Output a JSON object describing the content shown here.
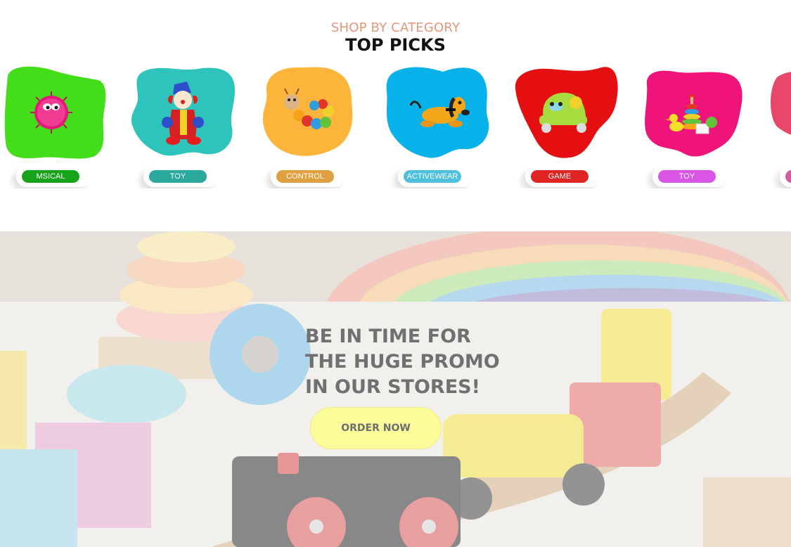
{
  "section": {
    "kicker": "SHOP BY CATEGORY",
    "title": "TOP PICKS"
  },
  "categories": [
    {
      "label": "MSICAL",
      "blob_color": "#44dd1a",
      "pill_color": "#18a41a",
      "toy": "pink-fluffy-ball"
    },
    {
      "label": "TOY",
      "blob_color": "#2fc4bb",
      "pill_color": "#2aa99c",
      "toy": "clown-doll"
    },
    {
      "label": "CONTROL",
      "blob_color": "#fcb53a",
      "pill_color": "#e1a040",
      "toy": "wooden-caterpillar"
    },
    {
      "label": "ACTIVEWEAR",
      "blob_color": "#09b1e9",
      "pill_color": "#4fc0dc",
      "toy": "plush-dog"
    },
    {
      "label": "GAME",
      "blob_color": "#e40f10",
      "pill_color": "#e02424",
      "toy": "toy-car"
    },
    {
      "label": "TOY",
      "blob_color": "#ee1479",
      "pill_color": "#d855e6",
      "toy": "stacking-rings-duck"
    },
    {
      "label": "",
      "blob_color": "#e8476a",
      "pill_color": "#d45aa0",
      "toy": ""
    }
  ],
  "promo": {
    "headline_1": "BE IN TIME FOR",
    "headline_2": "THE HUGE PROMO",
    "headline_3": "IN OUR STORES!",
    "button_label": "ORDER NOW",
    "button_color": "#fcfc9a"
  }
}
